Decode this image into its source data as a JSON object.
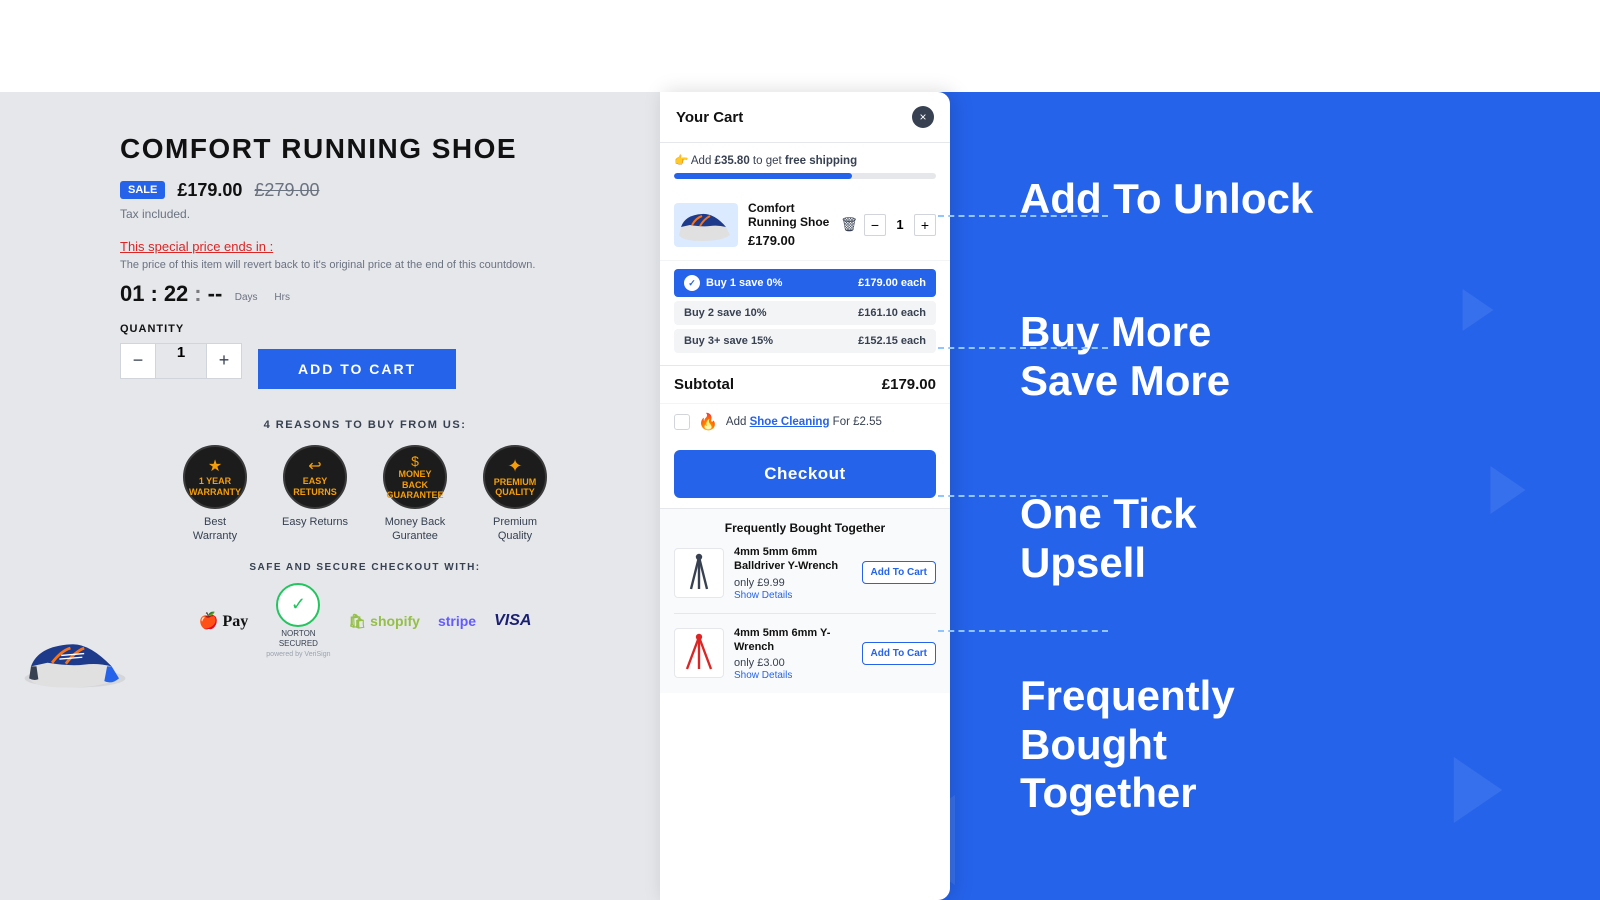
{
  "colors": {
    "blue": "#2563EB",
    "white": "#ffffff",
    "dark": "#111111",
    "gray": "#6b7280",
    "red": "#dc2626",
    "green": "#22c55e"
  },
  "header": {
    "bg": "white"
  },
  "product": {
    "title": "COMFORT RUNNING SHOE",
    "sale_badge": "SALE",
    "price_current": "£179.00",
    "price_original": "£279.00",
    "tax_note": "Tax included.",
    "special_price_label": "This special price ends in :",
    "countdown_desc": "The price of this item will revert back to it's original price at the end of this countdown.",
    "timer_hours": "01",
    "timer_minutes": "22",
    "timer_colon": ":",
    "timer_days_label": "Days",
    "timer_hrs_label": "Hrs",
    "qty_label": "QUANTITY",
    "qty_value": "1",
    "qty_minus": "−",
    "qty_plus": "+",
    "add_to_cart": "ADD TO CART",
    "reasons_title": "4 REASONS TO BUY FROM US:",
    "reasons": [
      {
        "id": "warranty",
        "icon": "★",
        "line1": "1 YEAR",
        "line2": "WARRANTY",
        "label": "Best\nWarranty"
      },
      {
        "id": "returns",
        "icon": "↩",
        "line1": "EASY",
        "line2": "RETURNS",
        "label": "Easy Returns"
      },
      {
        "id": "money-back",
        "icon": "$",
        "line1": "MONEY BACK",
        "line2": "GUARANTEE",
        "label": "Money Back\nGurantee"
      },
      {
        "id": "quality",
        "icon": "+",
        "line1": "PREMIUM",
        "line2": "QUALITY",
        "label": "Premium\nQuality"
      }
    ],
    "secure_title": "SAFE AND SECURE CHECKOUT WITH:",
    "payment_methods": [
      "Apple Pay",
      "Norton SECURED",
      "shopify",
      "stripe",
      "VISA"
    ]
  },
  "cart": {
    "title": "Your Cart",
    "close_label": "×",
    "shipping_msg_prefix": "👉 Add ",
    "shipping_amount": "£35.80",
    "shipping_msg_suffix": " to get ",
    "shipping_free": "free shipping",
    "progress_percent": 68,
    "item": {
      "name": "Comfort Running Shoe",
      "price": "£179.00",
      "qty": "1"
    },
    "tiers": [
      {
        "label": "Buy 1 save 0%",
        "price": "£179.00 each",
        "active": true
      },
      {
        "label": "Buy 2 save 10%",
        "price": "£161.10 each",
        "active": false
      },
      {
        "label": "Buy 3+ save 15%",
        "price": "£152.15 each",
        "active": false
      }
    ],
    "subtotal_label": "Subtotal",
    "subtotal_value": "£179.00",
    "upsell_text_pre": "Add ",
    "upsell_item": "Shoe Cleaning",
    "upsell_text_post": " For £2.55",
    "checkout_label": "Checkout",
    "fbt_title": "Frequently Bought Together",
    "fbt_items": [
      {
        "name": "4mm 5mm 6mm Balldriver Y-Wrench",
        "price": "only £9.99",
        "link": "Show Details",
        "btn": "Add To Cart",
        "emoji": "🔧"
      },
      {
        "name": "4mm 5mm 6mm Y-Wrench",
        "price": "only £3.00",
        "link": "Show Details",
        "btn": "Add To Cart",
        "emoji": "🔧"
      }
    ]
  },
  "annotations": {
    "add_to_unlock": "Add To Unlock",
    "buy_more_save_more": "Buy More\nSave More",
    "one_tick_upsell": "One Tick\nUpsell",
    "frequently_bought_together": "Frequently\nBought\nTogether"
  }
}
